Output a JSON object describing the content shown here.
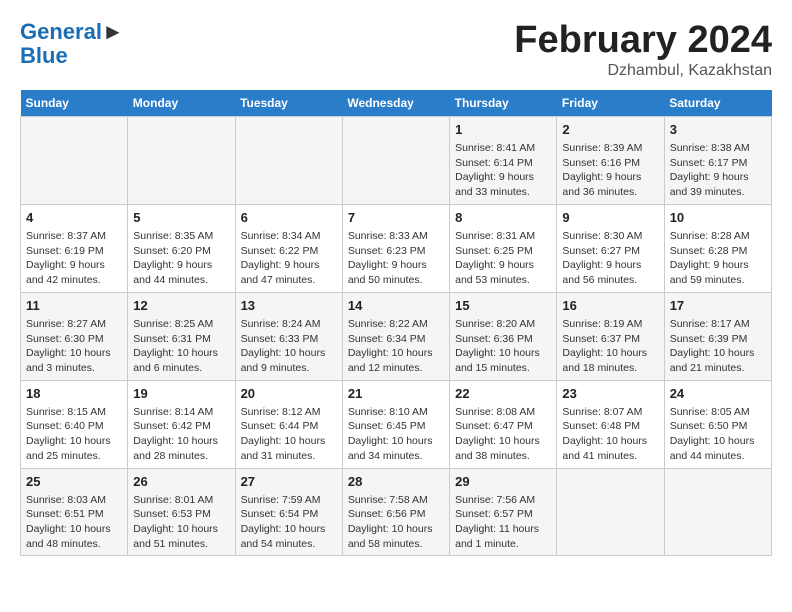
{
  "header": {
    "logo_line1": "General",
    "logo_line2": "Blue",
    "month": "February 2024",
    "location": "Dzhambul, Kazakhstan"
  },
  "days_of_week": [
    "Sunday",
    "Monday",
    "Tuesday",
    "Wednesday",
    "Thursday",
    "Friday",
    "Saturday"
  ],
  "weeks": [
    [
      {
        "day": "",
        "info": ""
      },
      {
        "day": "",
        "info": ""
      },
      {
        "day": "",
        "info": ""
      },
      {
        "day": "",
        "info": ""
      },
      {
        "day": "1",
        "info": "Sunrise: 8:41 AM\nSunset: 6:14 PM\nDaylight: 9 hours\nand 33 minutes."
      },
      {
        "day": "2",
        "info": "Sunrise: 8:39 AM\nSunset: 6:16 PM\nDaylight: 9 hours\nand 36 minutes."
      },
      {
        "day": "3",
        "info": "Sunrise: 8:38 AM\nSunset: 6:17 PM\nDaylight: 9 hours\nand 39 minutes."
      }
    ],
    [
      {
        "day": "4",
        "info": "Sunrise: 8:37 AM\nSunset: 6:19 PM\nDaylight: 9 hours\nand 42 minutes."
      },
      {
        "day": "5",
        "info": "Sunrise: 8:35 AM\nSunset: 6:20 PM\nDaylight: 9 hours\nand 44 minutes."
      },
      {
        "day": "6",
        "info": "Sunrise: 8:34 AM\nSunset: 6:22 PM\nDaylight: 9 hours\nand 47 minutes."
      },
      {
        "day": "7",
        "info": "Sunrise: 8:33 AM\nSunset: 6:23 PM\nDaylight: 9 hours\nand 50 minutes."
      },
      {
        "day": "8",
        "info": "Sunrise: 8:31 AM\nSunset: 6:25 PM\nDaylight: 9 hours\nand 53 minutes."
      },
      {
        "day": "9",
        "info": "Sunrise: 8:30 AM\nSunset: 6:27 PM\nDaylight: 9 hours\nand 56 minutes."
      },
      {
        "day": "10",
        "info": "Sunrise: 8:28 AM\nSunset: 6:28 PM\nDaylight: 9 hours\nand 59 minutes."
      }
    ],
    [
      {
        "day": "11",
        "info": "Sunrise: 8:27 AM\nSunset: 6:30 PM\nDaylight: 10 hours\nand 3 minutes."
      },
      {
        "day": "12",
        "info": "Sunrise: 8:25 AM\nSunset: 6:31 PM\nDaylight: 10 hours\nand 6 minutes."
      },
      {
        "day": "13",
        "info": "Sunrise: 8:24 AM\nSunset: 6:33 PM\nDaylight: 10 hours\nand 9 minutes."
      },
      {
        "day": "14",
        "info": "Sunrise: 8:22 AM\nSunset: 6:34 PM\nDaylight: 10 hours\nand 12 minutes."
      },
      {
        "day": "15",
        "info": "Sunrise: 8:20 AM\nSunset: 6:36 PM\nDaylight: 10 hours\nand 15 minutes."
      },
      {
        "day": "16",
        "info": "Sunrise: 8:19 AM\nSunset: 6:37 PM\nDaylight: 10 hours\nand 18 minutes."
      },
      {
        "day": "17",
        "info": "Sunrise: 8:17 AM\nSunset: 6:39 PM\nDaylight: 10 hours\nand 21 minutes."
      }
    ],
    [
      {
        "day": "18",
        "info": "Sunrise: 8:15 AM\nSunset: 6:40 PM\nDaylight: 10 hours\nand 25 minutes."
      },
      {
        "day": "19",
        "info": "Sunrise: 8:14 AM\nSunset: 6:42 PM\nDaylight: 10 hours\nand 28 minutes."
      },
      {
        "day": "20",
        "info": "Sunrise: 8:12 AM\nSunset: 6:44 PM\nDaylight: 10 hours\nand 31 minutes."
      },
      {
        "day": "21",
        "info": "Sunrise: 8:10 AM\nSunset: 6:45 PM\nDaylight: 10 hours\nand 34 minutes."
      },
      {
        "day": "22",
        "info": "Sunrise: 8:08 AM\nSunset: 6:47 PM\nDaylight: 10 hours\nand 38 minutes."
      },
      {
        "day": "23",
        "info": "Sunrise: 8:07 AM\nSunset: 6:48 PM\nDaylight: 10 hours\nand 41 minutes."
      },
      {
        "day": "24",
        "info": "Sunrise: 8:05 AM\nSunset: 6:50 PM\nDaylight: 10 hours\nand 44 minutes."
      }
    ],
    [
      {
        "day": "25",
        "info": "Sunrise: 8:03 AM\nSunset: 6:51 PM\nDaylight: 10 hours\nand 48 minutes."
      },
      {
        "day": "26",
        "info": "Sunrise: 8:01 AM\nSunset: 6:53 PM\nDaylight: 10 hours\nand 51 minutes."
      },
      {
        "day": "27",
        "info": "Sunrise: 7:59 AM\nSunset: 6:54 PM\nDaylight: 10 hours\nand 54 minutes."
      },
      {
        "day": "28",
        "info": "Sunrise: 7:58 AM\nSunset: 6:56 PM\nDaylight: 10 hours\nand 58 minutes."
      },
      {
        "day": "29",
        "info": "Sunrise: 7:56 AM\nSunset: 6:57 PM\nDaylight: 11 hours\nand 1 minute."
      },
      {
        "day": "",
        "info": ""
      },
      {
        "day": "",
        "info": ""
      }
    ]
  ]
}
